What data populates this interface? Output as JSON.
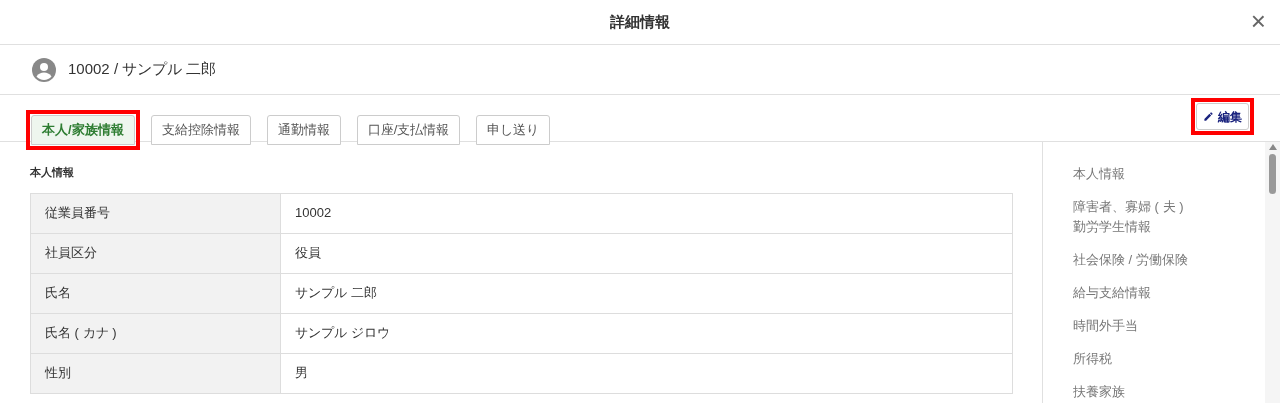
{
  "dialog": {
    "title": "詳細情報",
    "close": "×"
  },
  "employee": {
    "title": "10002 / サンプル 二郎"
  },
  "tabs": [
    {
      "label": "本人/家族情報",
      "selected": true,
      "highlighted": true
    },
    {
      "label": "支給控除情報",
      "selected": false,
      "highlighted": false
    },
    {
      "label": "通勤情報",
      "selected": false,
      "highlighted": false
    },
    {
      "label": "口座/支払情報",
      "selected": false,
      "highlighted": false
    },
    {
      "label": "申し送り",
      "selected": false,
      "highlighted": false
    }
  ],
  "edit_button": {
    "label": "編集",
    "highlighted": true
  },
  "section": {
    "title": "本人情報",
    "rows": [
      {
        "label": "従業員番号",
        "value": "10002"
      },
      {
        "label": "社員区分",
        "value": "役員"
      },
      {
        "label": "氏名",
        "value": "サンプル 二郎"
      },
      {
        "label": "氏名 ( カナ )",
        "value": "サンプル ジロウ"
      },
      {
        "label": "性別",
        "value": "男"
      }
    ]
  },
  "side_nav": [
    {
      "lines": [
        "本人情報"
      ]
    },
    {
      "lines": [
        "障害者、寡婦 ( 夫 )",
        "勤労学生情報"
      ]
    },
    {
      "lines": [
        "社会保険 / 労働保険"
      ]
    },
    {
      "lines": [
        "給与支給情報"
      ]
    },
    {
      "lines": [
        "時間外手当"
      ]
    },
    {
      "lines": [
        "所得税"
      ]
    },
    {
      "lines": [
        "扶養家族"
      ]
    }
  ]
}
